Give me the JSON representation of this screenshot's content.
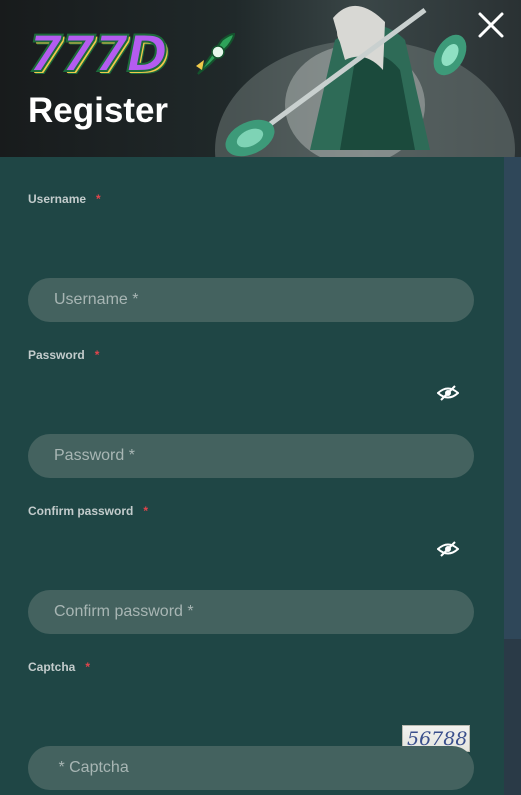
{
  "header": {
    "logo_text": "777D",
    "title": "Register",
    "close_icon": "close-icon"
  },
  "form": {
    "username": {
      "label": "Username",
      "required_mark": "*",
      "placeholder": "Username *"
    },
    "password": {
      "label": "Password",
      "required_mark": "*",
      "placeholder": "Password *",
      "toggle_icon": "eye-off-icon"
    },
    "confirm_password": {
      "label": "Confirm password",
      "required_mark": "*",
      "placeholder": "Confirm password *",
      "toggle_icon": "eye-off-icon"
    },
    "captcha": {
      "label": "Captcha",
      "required_mark": "*",
      "placeholder": " * Captcha",
      "image_text": "56788"
    }
  },
  "colors": {
    "background": "#1f4645",
    "input_fill": "#44625f",
    "required": "#e0454c",
    "label": "#c3cccc"
  }
}
